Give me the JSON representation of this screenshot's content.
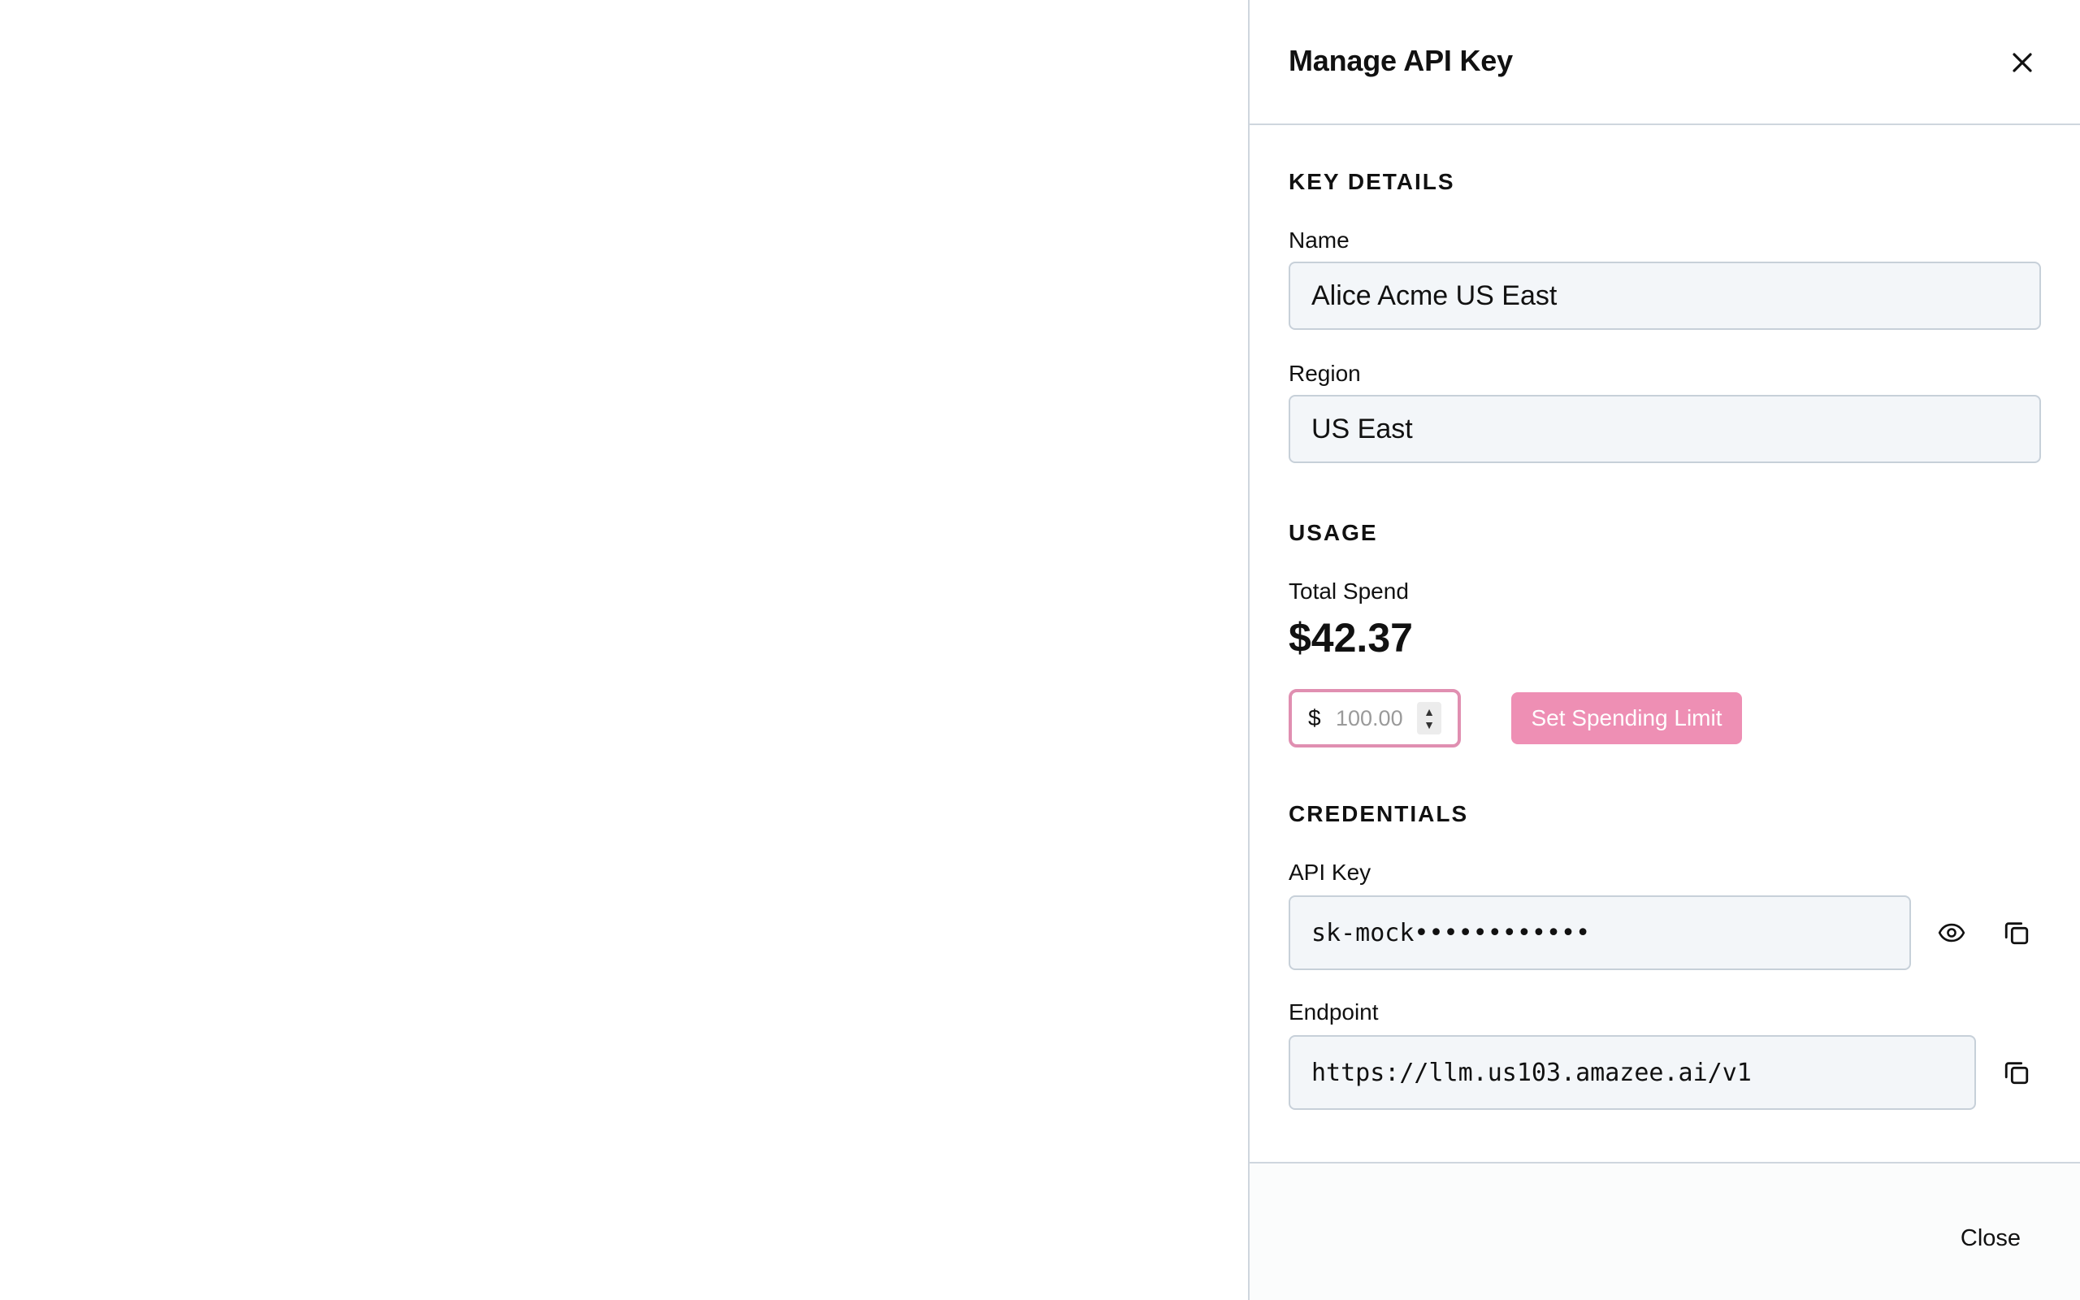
{
  "panel": {
    "title": "Manage API Key",
    "close_icon": "close-icon"
  },
  "key_details": {
    "section_title": "KEY DETAILS",
    "name_label": "Name",
    "name_value": "Alice Acme US East",
    "region_label": "Region",
    "region_value": "US East"
  },
  "usage": {
    "section_title": "USAGE",
    "total_spend_label": "Total Spend",
    "total_spend_value": "$42.37",
    "limit_currency": "$",
    "limit_placeholder": "100.00",
    "set_limit_label": "Set Spending Limit"
  },
  "credentials": {
    "section_title": "CREDENTIALS",
    "api_key_label": "API Key",
    "api_key_value": "sk-mock••••••••••••",
    "endpoint_label": "Endpoint",
    "endpoint_value": "https://llm.us103.amazee.ai/v1",
    "reveal_icon": "eye-icon",
    "copy_icon": "copy-icon"
  },
  "footer": {
    "close_label": "Close"
  },
  "colors": {
    "accent": "#ee8fb4",
    "accent_border": "#e08fb1",
    "field_bg": "#f3f6f9",
    "divider": "#cfd6de"
  }
}
